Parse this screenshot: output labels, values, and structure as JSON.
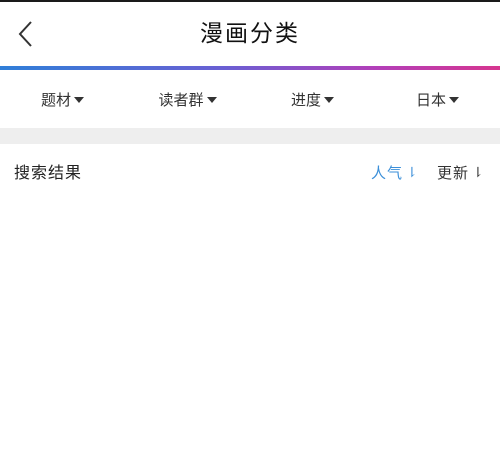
{
  "header": {
    "title": "漫画分类",
    "back_icon": "chevron-left-icon"
  },
  "colors": {
    "accent_gradient": [
      "#2f7fd8",
      "#6a5fd3",
      "#b23fb9",
      "#d6358f"
    ],
    "sort_active": "#3b8fd9",
    "divider": "#eeeeee"
  },
  "filters": [
    {
      "label": "题材"
    },
    {
      "label": "读者群"
    },
    {
      "label": "进度"
    },
    {
      "label": "日本"
    }
  ],
  "results": {
    "title": "搜索结果",
    "sort_popular": "人气",
    "sort_updated": "更新",
    "sort_icon": "sort-descending-icon",
    "active_sort": "人气"
  }
}
